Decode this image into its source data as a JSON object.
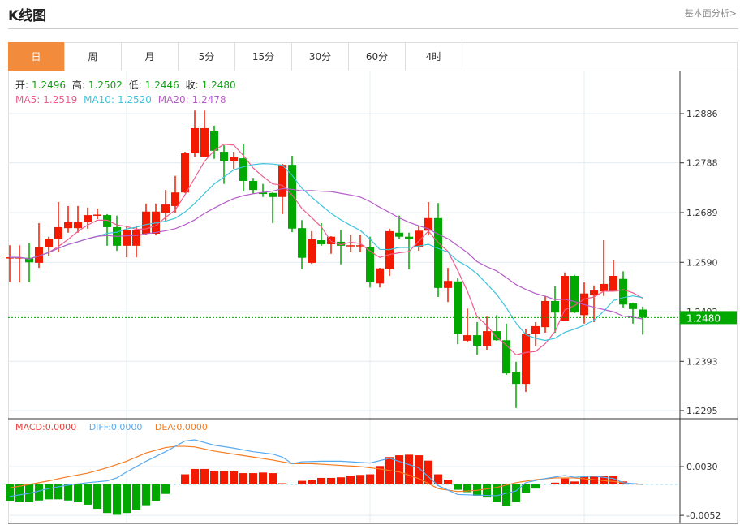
{
  "header": {
    "title": "K线图",
    "link": "基本面分析>"
  },
  "tabs": [
    {
      "label": "日",
      "active": true
    },
    {
      "label": "周"
    },
    {
      "label": "月"
    },
    {
      "label": "5分"
    },
    {
      "label": "15分"
    },
    {
      "label": "30分"
    },
    {
      "label": "60分"
    },
    {
      "label": "4时"
    }
  ],
  "info": {
    "open_label": "开:",
    "open": "1.2496",
    "high_label": "高:",
    "high": "1.2502",
    "low_label": "低:",
    "low": "1.2446",
    "close_label": "收:",
    "close": "1.2480",
    "ma5_label": "MA5:",
    "ma5": "1.2519",
    "ma10_label": "MA10:",
    "ma10": "1.2520",
    "ma20_label": "MA20:",
    "ma20": "1.2478"
  },
  "macd_info": {
    "macd_label": "MACD:",
    "macd": "0.0000",
    "diff_label": "DIFF:",
    "diff": "0.0000",
    "dea_label": "DEA:",
    "dea": "0.0000"
  },
  "colors": {
    "up": "#f21a00",
    "down": "#00a800",
    "ma5": "#ee5c8c",
    "ma10": "#3cc4dc",
    "ma20": "#b65cc8",
    "diff": "#58aaf0",
    "dea": "#f57c20",
    "accent": "#f28c3c"
  },
  "chart_data": [
    {
      "type": "candlestick",
      "title": "K线图",
      "y_ticks": [
        "1.2886",
        "1.2788",
        "1.2689",
        "1.2590",
        "1.2492",
        "1.2393",
        "1.2295"
      ],
      "current_price": "1.2480",
      "ohlc": [
        [
          1.2599,
          1.2624,
          1.255,
          1.26
        ],
        [
          1.2599,
          1.2624,
          1.255,
          1.26
        ],
        [
          1.2599,
          1.2629,
          1.255,
          1.259
        ],
        [
          1.2589,
          1.2668,
          1.2579,
          1.2621
        ],
        [
          1.2621,
          1.2641,
          1.2602,
          1.2637
        ],
        [
          1.2636,
          1.271,
          1.2611,
          1.266
        ],
        [
          1.2658,
          1.2702,
          1.2649,
          1.267
        ],
        [
          1.2658,
          1.2702,
          1.2649,
          1.267
        ],
        [
          1.2671,
          1.2699,
          1.2657,
          1.2684
        ],
        [
          1.2684,
          1.2697,
          1.2676,
          1.2685
        ],
        [
          1.2684,
          1.2686,
          1.2623,
          1.266
        ],
        [
          1.266,
          1.2683,
          1.2613,
          1.2623
        ],
        [
          1.2623,
          1.2663,
          1.26,
          1.2655
        ],
        [
          1.2623,
          1.2663,
          1.26,
          1.2655
        ],
        [
          1.2647,
          1.2707,
          1.2644,
          1.2691
        ],
        [
          1.2647,
          1.2707,
          1.2644,
          1.2691
        ],
        [
          1.2689,
          1.2734,
          1.2673,
          1.2705
        ],
        [
          1.2702,
          1.2762,
          1.2689,
          1.2729
        ],
        [
          1.2729,
          1.281,
          1.2728,
          1.2807
        ],
        [
          1.2807,
          1.2892,
          1.28,
          1.2857
        ],
        [
          1.28,
          1.2892,
          1.28,
          1.2857
        ],
        [
          1.2852,
          1.2862,
          1.2796,
          1.2812
        ],
        [
          1.281,
          1.2823,
          1.2746,
          1.2792
        ],
        [
          1.2791,
          1.281,
          1.2776,
          1.2799
        ],
        [
          1.2797,
          1.2825,
          1.2731,
          1.2752
        ],
        [
          1.2752,
          1.2758,
          1.2726,
          1.2734
        ],
        [
          1.2729,
          1.2746,
          1.272,
          1.2726
        ],
        [
          1.2728,
          1.2729,
          1.2668,
          1.272
        ],
        [
          1.272,
          1.2786,
          1.2686,
          1.2784
        ],
        [
          1.2784,
          1.2802,
          1.265,
          1.2657
        ],
        [
          1.2658,
          1.2674,
          1.2576,
          1.2599
        ],
        [
          1.2589,
          1.2652,
          1.2587,
          1.2636
        ],
        [
          1.2634,
          1.2668,
          1.2623,
          1.2626
        ],
        [
          1.2626,
          1.2642,
          1.2607,
          1.2641
        ],
        [
          1.2631,
          1.2655,
          1.2586,
          1.2623
        ],
        [
          1.2623,
          1.2645,
          1.261,
          1.2624
        ],
        [
          1.2623,
          1.2645,
          1.261,
          1.2624
        ],
        [
          1.2621,
          1.2641,
          1.254,
          1.255
        ],
        [
          1.2548,
          1.2579,
          1.254,
          1.2578
        ],
        [
          1.2576,
          1.2657,
          1.2563,
          1.2652
        ],
        [
          1.2649,
          1.2683,
          1.2636,
          1.2641
        ],
        [
          1.2641,
          1.2649,
          1.2576,
          1.2636
        ],
        [
          1.2621,
          1.2663,
          1.2613,
          1.2653
        ],
        [
          1.2653,
          1.271,
          1.2644,
          1.2678
        ],
        [
          1.2678,
          1.2708,
          1.2521,
          1.2539
        ],
        [
          1.2539,
          1.2579,
          1.2511,
          1.2553
        ],
        [
          1.2552,
          1.2558,
          1.2427,
          1.2448
        ],
        [
          1.2434,
          1.2498,
          1.2431,
          1.2445
        ],
        [
          1.2445,
          1.2471,
          1.2406,
          1.2424
        ],
        [
          1.2424,
          1.2482,
          1.2416,
          1.2453
        ],
        [
          1.2453,
          1.2485,
          1.2434,
          1.2435
        ],
        [
          1.2435,
          1.2468,
          1.2366,
          1.2369
        ],
        [
          1.2372,
          1.2392,
          1.23,
          1.2348
        ],
        [
          1.2348,
          1.2458,
          1.2332,
          1.2448
        ],
        [
          1.2448,
          1.2471,
          1.2423,
          1.2463
        ],
        [
          1.2461,
          1.2523,
          1.245,
          1.2513
        ],
        [
          1.2513,
          1.2542,
          1.245,
          1.249
        ],
        [
          1.2474,
          1.257,
          1.2474,
          1.2563
        ],
        [
          1.2563,
          1.2565,
          1.2489,
          1.249
        ],
        [
          1.2485,
          1.255,
          1.2468,
          1.2528
        ],
        [
          1.2524,
          1.2544,
          1.2471,
          1.2534
        ],
        [
          1.2532,
          1.2634,
          1.2523,
          1.2547
        ],
        [
          1.2532,
          1.2594,
          1.2532,
          1.2563
        ],
        [
          1.2557,
          1.2572,
          1.25,
          1.2506
        ],
        [
          1.2508,
          1.251,
          1.2468,
          1.2497
        ],
        [
          1.2496,
          1.2502,
          1.2446,
          1.248
        ]
      ]
    },
    {
      "type": "macd",
      "y_ticks": [
        "0.0030",
        "-0.0052"
      ],
      "histogram": [
        -0.0028,
        -0.003,
        -0.003,
        -0.0027,
        -0.0025,
        -0.0025,
        -0.0027,
        -0.003,
        -0.0034,
        -0.0041,
        -0.0048,
        -0.0051,
        -0.0048,
        -0.0043,
        -0.0035,
        -0.0028,
        -0.0016,
        0,
        0.0017,
        0.0026,
        0.0026,
        0.0022,
        0.0022,
        0.0022,
        0.0019,
        0.0019,
        0.002,
        0.0019,
        0.0002,
        0,
        0.0006,
        0.0008,
        0.0011,
        0.0011,
        0.0012,
        0.0015,
        0.0016,
        0.0017,
        0.0031,
        0.0046,
        0.0049,
        0.005,
        0.0049,
        0.004,
        0.0017,
        0.0008,
        -0.0009,
        -0.0013,
        -0.0019,
        -0.0022,
        -0.003,
        -0.0036,
        -0.003,
        -0.0014,
        -0.0007,
        0,
        0.0003,
        0.001,
        0.0005,
        0.0013,
        0.0015,
        0.0015,
        0.0014,
        0.0005,
        0.0002,
        0
      ],
      "diff": [
        [
          0,
          -0.002
        ],
        [
          2,
          -0.0015
        ],
        [
          4,
          -0.0007
        ],
        [
          6,
          -0.0001
        ],
        [
          8,
          0.0003
        ],
        [
          10,
          0.0006
        ],
        [
          11,
          0.0011
        ],
        [
          12,
          0.0021
        ],
        [
          14,
          0.0039
        ],
        [
          16,
          0.0055
        ],
        [
          18,
          0.0073
        ],
        [
          19,
          0.0075
        ],
        [
          21,
          0.0066
        ],
        [
          23,
          0.0061
        ],
        [
          25,
          0.0055
        ],
        [
          27,
          0.0051
        ],
        [
          28,
          0.0046
        ],
        [
          29,
          0.0035
        ],
        [
          30,
          0.0038
        ],
        [
          32,
          0.0039
        ],
        [
          34,
          0.0039
        ],
        [
          37,
          0.0036
        ],
        [
          39,
          0.0044
        ],
        [
          42,
          0.0028
        ],
        [
          44,
          -0.0002
        ],
        [
          46,
          -0.0017
        ],
        [
          48,
          -0.0018
        ],
        [
          50,
          -0.0019
        ],
        [
          52,
          -0.0011
        ],
        [
          53,
          0.0003
        ],
        [
          55,
          0.001
        ],
        [
          57,
          0.0015
        ],
        [
          58,
          0.0012
        ],
        [
          60,
          0.0014
        ],
        [
          62,
          0.001
        ],
        [
          63,
          0.0003
        ],
        [
          65,
          0
        ]
      ],
      "dea": [
        [
          0,
          -0.0006
        ],
        [
          2,
          0.0
        ],
        [
          4,
          0.0006
        ],
        [
          6,
          0.0013
        ],
        [
          8,
          0.0019
        ],
        [
          10,
          0.0028
        ],
        [
          12,
          0.0039
        ],
        [
          14,
          0.0053
        ],
        [
          16,
          0.0062
        ],
        [
          17,
          0.0064
        ],
        [
          18,
          0.0064
        ],
        [
          19,
          0.0063
        ],
        [
          21,
          0.0056
        ],
        [
          23,
          0.0051
        ],
        [
          25,
          0.0046
        ],
        [
          27,
          0.0041
        ],
        [
          29,
          0.0035
        ],
        [
          31,
          0.0035
        ],
        [
          33,
          0.0033
        ],
        [
          34,
          0.0032
        ],
        [
          36,
          0.003
        ],
        [
          38,
          0.0026
        ],
        [
          40,
          0.0021
        ],
        [
          42,
          0.001
        ],
        [
          44,
          -0.0007
        ],
        [
          46,
          -0.0012
        ],
        [
          48,
          -0.001
        ],
        [
          50,
          -0.0005
        ],
        [
          52,
          0.0003
        ],
        [
          54,
          0.0008
        ],
        [
          56,
          0.0011
        ],
        [
          58,
          0.0011
        ],
        [
          60,
          0.0008
        ],
        [
          62,
          0.0005
        ],
        [
          64,
          0.0001
        ],
        [
          65,
          0
        ]
      ]
    }
  ]
}
